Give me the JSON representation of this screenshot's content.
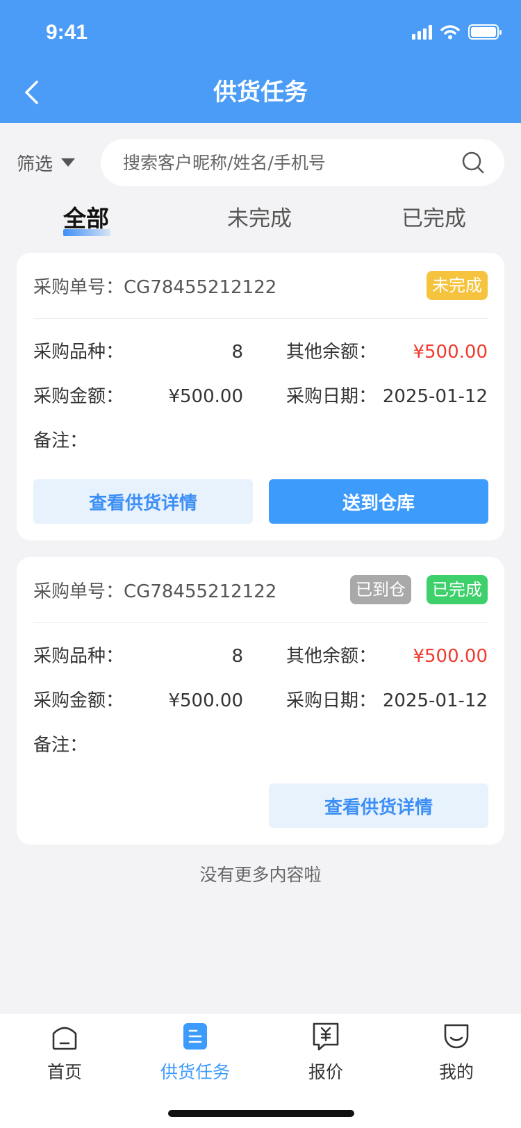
{
  "status_bar": {
    "time": "9:41"
  },
  "header": {
    "title": "供货任务"
  },
  "filter": {
    "label": "筛选"
  },
  "search": {
    "placeholder": "搜索客户昵称/姓名/手机号"
  },
  "tabs": [
    {
      "label": "全部",
      "active": true
    },
    {
      "label": "未完成",
      "active": false
    },
    {
      "label": "已完成",
      "active": false
    }
  ],
  "orders": [
    {
      "order_label": "采购单号：",
      "order_no": "CG78455212122",
      "badges": [
        "未完成"
      ],
      "variety_label": "采购品种：",
      "variety_value": "8",
      "balance_label": "其他余额：",
      "balance_value": "¥500.00",
      "amount_label": "采购金额：",
      "amount_value": "¥500.00",
      "date_label": "采购日期：",
      "date_value": "2025-01-12",
      "remark_label": "备注：",
      "buttons": [
        "查看供货详情",
        "送到仓库"
      ]
    },
    {
      "order_label": "采购单号：",
      "order_no": "CG78455212122",
      "badges": [
        "已到仓",
        "已完成"
      ],
      "variety_label": "采购品种：",
      "variety_value": "8",
      "balance_label": "其他余额：",
      "balance_value": "¥500.00",
      "amount_label": "采购金额：",
      "amount_value": "¥500.00",
      "date_label": "采购日期：",
      "date_value": "2025-01-12",
      "remark_label": "备注：",
      "buttons": [
        "查看供货详情"
      ]
    }
  ],
  "footer_text": "没有更多内容啦",
  "tabbar": [
    {
      "label": "首页",
      "icon": "home-icon"
    },
    {
      "label": "供货任务",
      "icon": "task-list-icon",
      "active": true
    },
    {
      "label": "报价",
      "icon": "quote-icon"
    },
    {
      "label": "我的",
      "icon": "profile-icon"
    }
  ],
  "colors": {
    "primary": "#4a9cf7",
    "price_red": "#ef3b2d",
    "badge_pending": "#f6c33e",
    "badge_arrived": "#a9a9a9",
    "badge_done": "#3dd06b"
  }
}
